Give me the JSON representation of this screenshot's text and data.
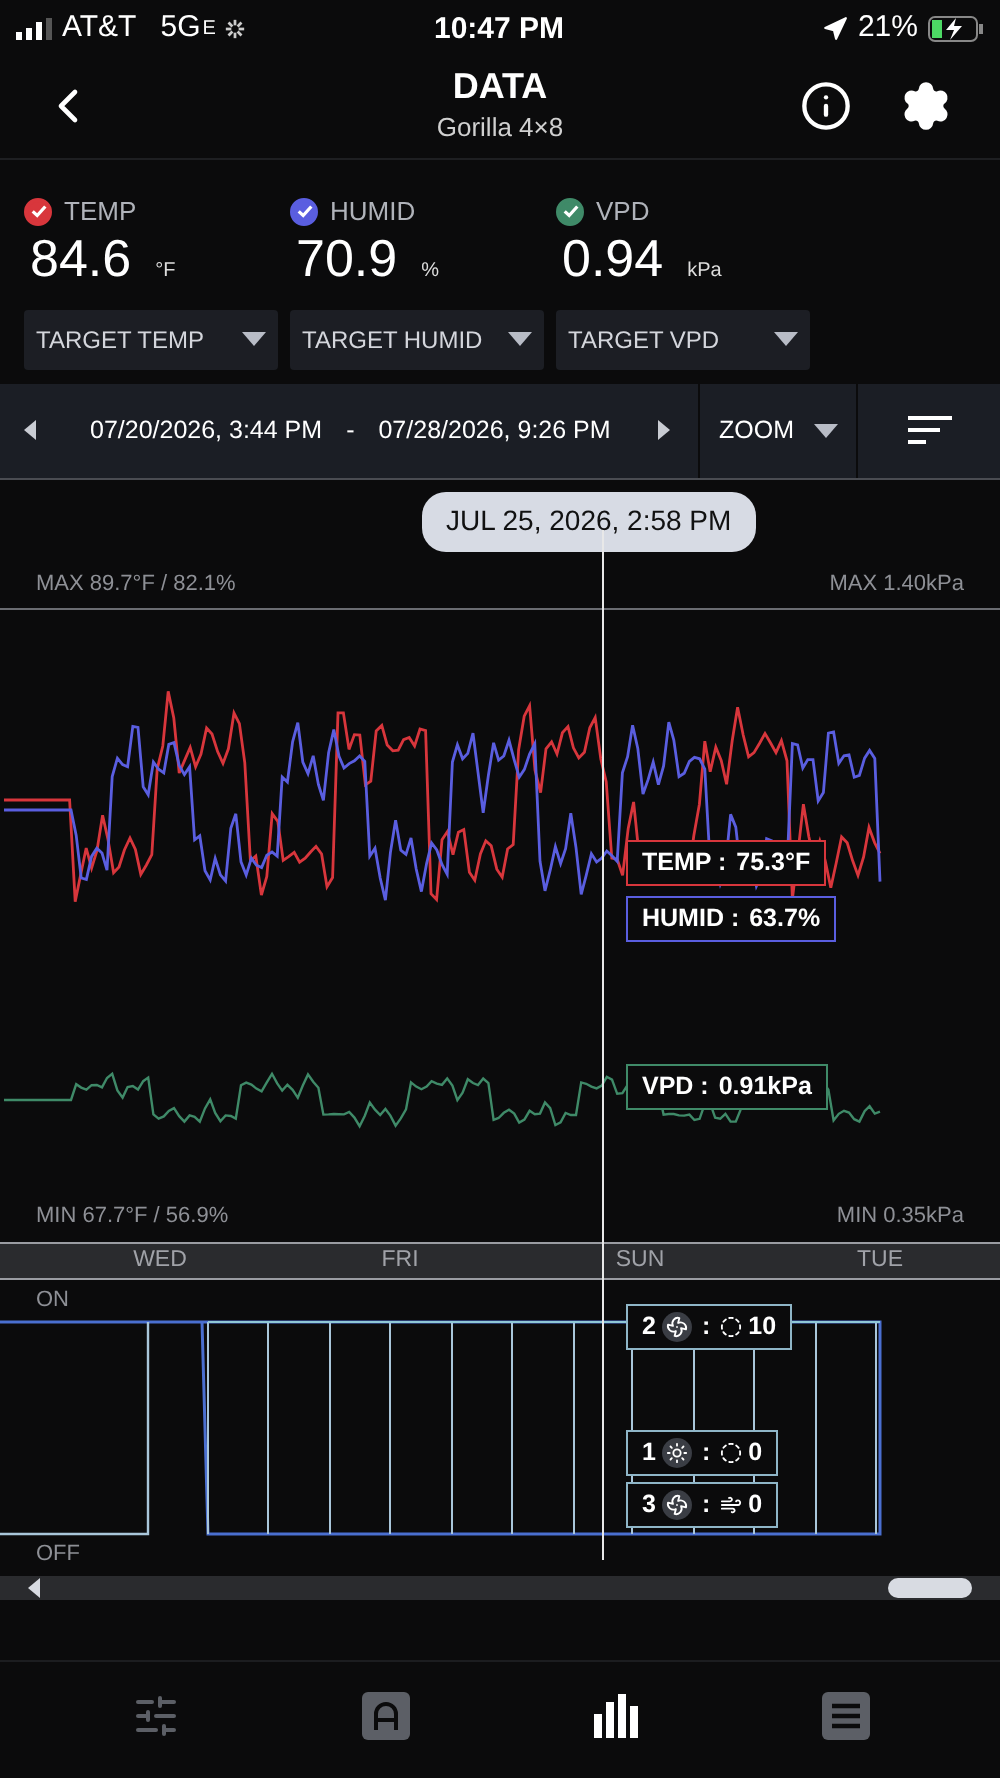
{
  "status_bar": {
    "carrier": "AT&T",
    "network": "5G",
    "network_suffix": "E",
    "time": "10:47 PM",
    "battery": "21%"
  },
  "header": {
    "title": "DATA",
    "subtitle": "Gorilla 4×8"
  },
  "metrics": [
    {
      "label": "TEMP",
      "value": "84.6",
      "unit": "°F",
      "checked": true,
      "color": "#d8363c"
    },
    {
      "label": "HUMID",
      "value": "70.9",
      "unit": "%",
      "checked": true,
      "color": "#5a5ee0"
    },
    {
      "label": "VPD",
      "value": "0.94",
      "unit": "kPa",
      "checked": true,
      "color": "#3f8a68"
    }
  ],
  "targets": [
    "TARGET TEMP",
    "TARGET HUMID",
    "TARGET VPD"
  ],
  "range": {
    "start": "07/20/2026, 3:44 PM",
    "separator": "-",
    "end": "07/28/2026, 9:26 PM",
    "zoom": "ZOOM"
  },
  "chart": {
    "cursor_label": "JUL 25, 2026, 2:58 PM",
    "max_left": "MAX 89.7°F / 82.1%",
    "max_right": "MAX 1.40kPa",
    "min_left": "MIN 67.7°F / 56.9%",
    "min_right": "MIN 0.35kPa",
    "readouts": [
      {
        "label": "TEMP :",
        "value": "75.3°F",
        "color": "#d8363c"
      },
      {
        "label": "HUMID :",
        "value": "63.7%",
        "color": "#5a5ee0"
      },
      {
        "label": "VPD :",
        "value": "0.91kPa",
        "color": "#3f8a68"
      }
    ],
    "days": [
      "WED",
      "FRI",
      "SUN",
      "TUE"
    ],
    "on_label": "ON",
    "off_label": "OFF",
    "devices": [
      {
        "number": "2",
        "kind": "fan",
        "separator": ":",
        "mode": {
          "kind": "cycle"
        },
        "value": "10"
      },
      {
        "number": "1",
        "kind": "light",
        "separator": ":",
        "mode": {
          "kind": "cycle"
        },
        "value": "0"
      },
      {
        "number": "3",
        "kind": "fan",
        "separator": ":",
        "mode": {
          "kind": "wind"
        },
        "value": "0"
      }
    ]
  },
  "tabs": [
    {
      "kind": "controls",
      "selected": false
    },
    {
      "kind": "mode",
      "selected": false
    },
    {
      "kind": "data",
      "selected": true
    },
    {
      "kind": "log",
      "selected": false
    }
  ]
}
